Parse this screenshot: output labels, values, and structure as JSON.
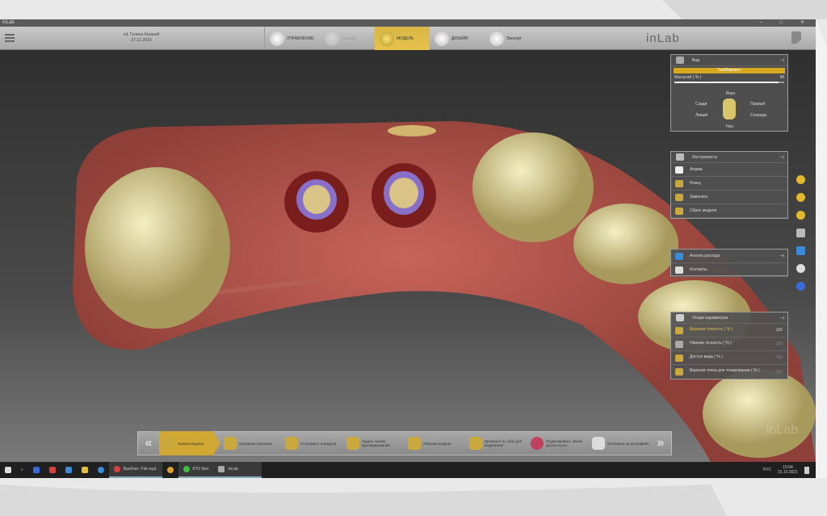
{
  "window": {
    "title": "inLab",
    "controls": "– □ ✕"
  },
  "toolbar": {
    "patient_name": "vd, Галина Козакай",
    "patient_date": "27.12.2020",
    "steps": [
      {
        "label": "УПРАВЛЕНИЕ",
        "state": "normal"
      },
      {
        "label": "Сканир.",
        "state": "disabled"
      },
      {
        "label": "МОДЕЛЬ",
        "state": "active"
      },
      {
        "label": "ДИЗАЙН",
        "state": "normal"
      },
      {
        "label": "Экспорт",
        "state": "normal"
      }
    ],
    "brand": "inLab"
  },
  "view_panel": {
    "title": "Вид",
    "mode": "Тип/Вариант",
    "scale_label": "Масштаб ( % )",
    "scale_value": "98",
    "scale_fraction": 0.95,
    "top": "Верх",
    "back": "Сзади",
    "right": "Правый",
    "left": "Левый",
    "front": "Спереди",
    "bottom": "Низ"
  },
  "tools_panel": {
    "title": "Инструменты",
    "items": [
      "Форма",
      "Резец",
      "Заменить",
      "Сброс модели"
    ]
  },
  "analysis_panel": {
    "items": [
      "Анализ расхода",
      "Контакты"
    ]
  },
  "params_panel": {
    "title": "Опции параметров",
    "items": [
      {
        "label": "Верхняя точность ( % )",
        "value": "100"
      },
      {
        "label": "Нижняя точность ( % )",
        "value": "100"
      },
      {
        "label": "Доступ вида ( % )",
        "value": "100"
      },
      {
        "label": "Верхняя точка для тонирования ( % )",
        "value": "100"
      }
    ]
  },
  "workflow": {
    "prev": "«",
    "next": "»",
    "steps": [
      "Правка модели",
      "Проверка окклюзии",
      "Установить в модели",
      "Задать линию препарирования",
      "Обрезка модели",
      "Щелкните по зубу для выделения",
      "Редактировать линии десны и рол...",
      "Установка на интерфейс"
    ]
  },
  "watermark": "inLab",
  "taskbar": {
    "apps": [
      "Windows file explorer",
      "Почта",
      "Edge",
      "Хром",
      "Эксплорер"
    ],
    "open": [
      "Вахбокс: File expl.",
      "КТО Nex",
      "inLab"
    ],
    "lang": "РУС",
    "time": "15:04",
    "date": "31.10.2021"
  },
  "colors": {
    "accent": "#d7a81d",
    "panel": "#505050"
  }
}
